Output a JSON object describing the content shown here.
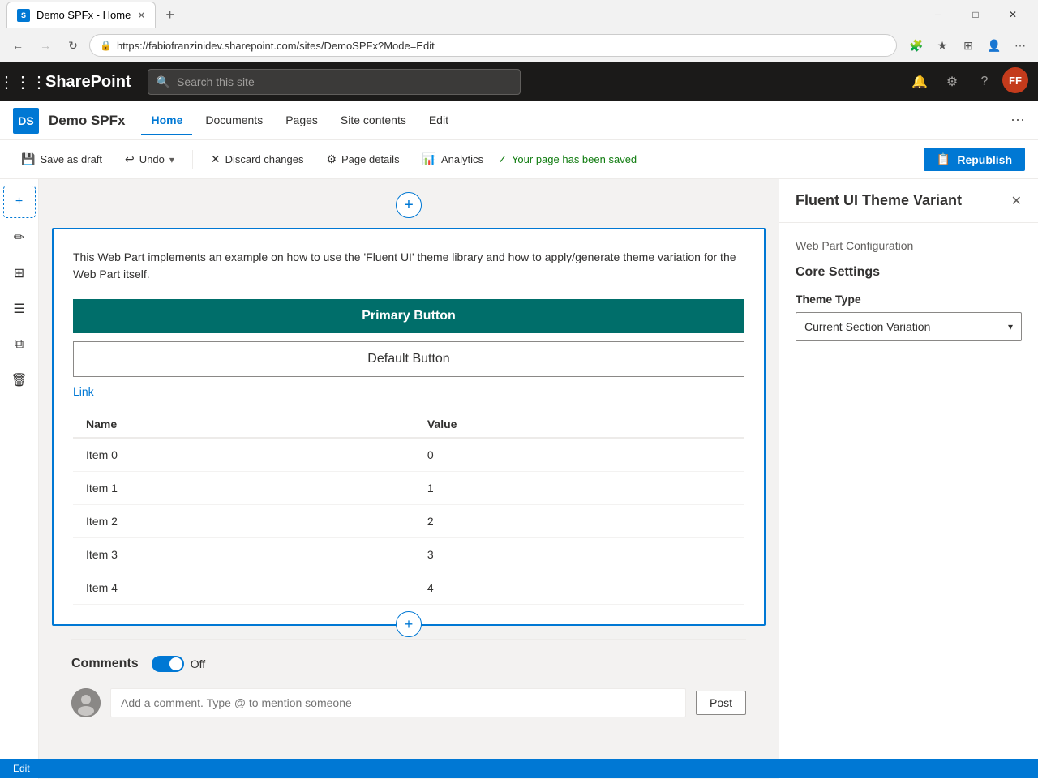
{
  "browser": {
    "tab_title": "Demo SPFx - Home",
    "url": "https://fabiofranzinidev.sharepoint.com/sites/DemoSPFx?Mode=Edit",
    "new_tab_icon": "+",
    "back_btn": "←",
    "forward_btn": "→",
    "refresh_btn": "↻",
    "close_btn": "✕",
    "minimize_btn": "─",
    "maximize_btn": "□"
  },
  "sharepoint": {
    "logo": "SharePoint",
    "search_placeholder": "Search this site",
    "site_title": "Demo SPFx",
    "nav_items": [
      {
        "label": "Home",
        "active": true
      },
      {
        "label": "Documents",
        "active": false
      },
      {
        "label": "Pages",
        "active": false
      },
      {
        "label": "Site contents",
        "active": false
      },
      {
        "label": "Edit",
        "active": false
      }
    ]
  },
  "toolbar": {
    "save_as_draft": "Save as draft",
    "undo": "Undo",
    "discard_changes": "Discard changes",
    "page_details": "Page details",
    "analytics": "Analytics",
    "saved_message": "Your page has been saved",
    "republish": "Republish"
  },
  "webpart": {
    "description": "This Web Part implements an example on how to use the 'Fluent UI' theme library and how to apply/generate theme variation for the Web Part itself.",
    "primary_button": "Primary Button",
    "default_button": "Default Button",
    "link_text": "Link",
    "table_col_name": "Name",
    "table_col_value": "Value",
    "table_rows": [
      {
        "name": "Item 0",
        "value": "0"
      },
      {
        "name": "Item 1",
        "value": "1"
      },
      {
        "name": "Item 2",
        "value": "2"
      },
      {
        "name": "Item 3",
        "value": "3"
      },
      {
        "name": "Item 4",
        "value": "4"
      }
    ]
  },
  "comments": {
    "title": "Comments",
    "toggle_state": "Off",
    "input_placeholder": "Add a comment. Type @ to mention someone",
    "post_button": "Post"
  },
  "right_panel": {
    "title": "Fluent UI Theme Variant",
    "subtitle": "Web Part Configuration",
    "core_settings": "Core Settings",
    "theme_type_label": "Theme Type",
    "theme_type_value": "Current Section Variation"
  },
  "bottom_bar": {
    "text": "Edit"
  },
  "colors": {
    "sp_dark": "#1b1a19",
    "primary_blue": "#0078d4",
    "teal": "#006e6a",
    "white": "#ffffff",
    "light_gray": "#f3f2f1"
  }
}
